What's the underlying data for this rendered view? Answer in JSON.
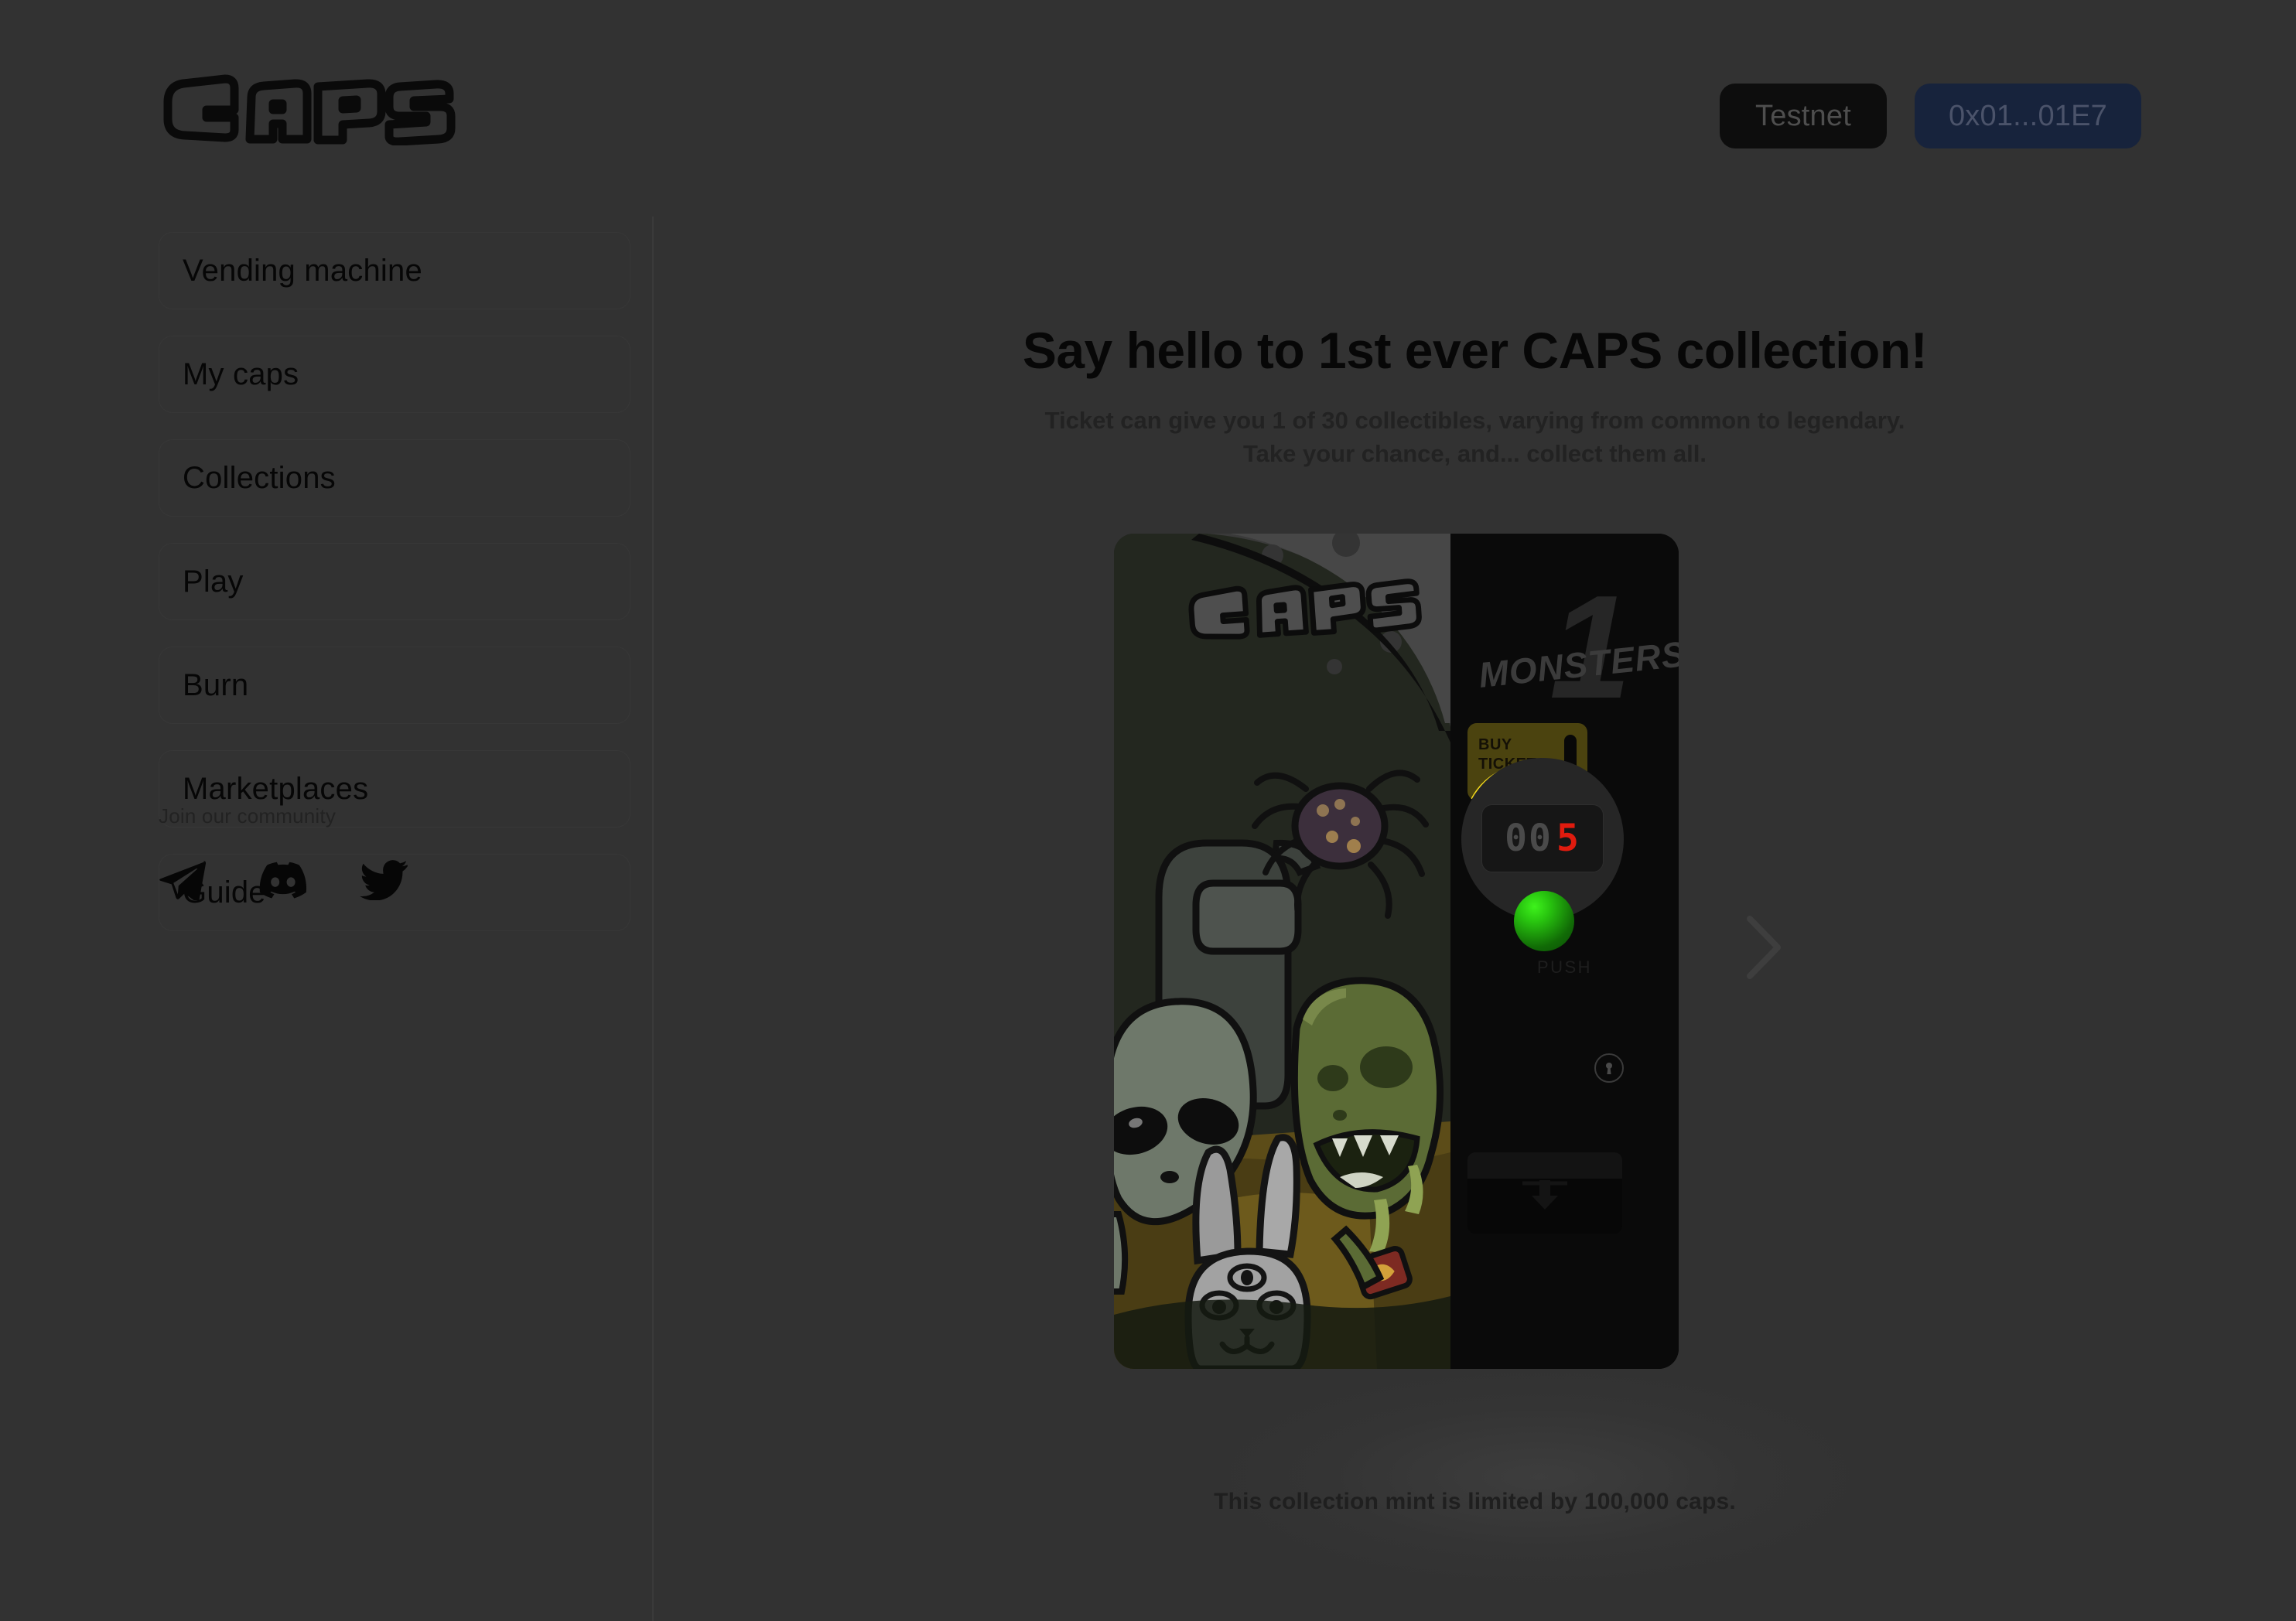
{
  "header": {
    "logo_text": "CAPS",
    "logo_icon": "caps-wordmark-logo",
    "network_label": "Testnet",
    "wallet_label": "0x01...01E7"
  },
  "sidebar": {
    "items": [
      {
        "label": "Vending machine",
        "name": "vending-machine"
      },
      {
        "label": "My caps",
        "name": "my-caps"
      },
      {
        "label": "Collections",
        "name": "collections"
      },
      {
        "label": "Play",
        "name": "play"
      },
      {
        "label": "Burn",
        "name": "burn"
      },
      {
        "label": "Marketplaces",
        "name": "marketplaces"
      },
      {
        "label": "Guide",
        "name": "guide"
      }
    ],
    "community": {
      "title": "Join our community",
      "socials": [
        {
          "icon": "telegram-icon",
          "name": "telegram"
        },
        {
          "icon": "discord-icon",
          "name": "discord"
        },
        {
          "icon": "twitter-icon",
          "name": "twitter"
        }
      ]
    }
  },
  "main": {
    "title": "Say hello to 1st ever CAPS collection!",
    "subtitle_line1": "Ticket can give you 1 of 30 collectibles, varying from common to legendary.",
    "subtitle_line2": "Take your chance, and... collect them all.",
    "footnote": "This collection mint is limited by 100,000 caps.",
    "carousel_next_icon": "chevron-right-icon",
    "machine": {
      "poster_logo": "CAPS",
      "brand_number": "1",
      "brand_name": "MONSTERS",
      "ticket_label_line1": "BUY",
      "ticket_label_line2": "TICKETS",
      "counter_dim": "00",
      "counter_on": "5",
      "push_label": "PUSH",
      "keyhole_icon": "keyhole-icon",
      "tray_icon": "down-arrow-icon"
    }
  },
  "colors": {
    "background": "#323232",
    "panel_black": "#0a0a0a",
    "wallet_pill": "#17233c",
    "ticket_yellow": "#f2d81c",
    "counter_red": "#e01b0e",
    "push_green": "#28c40f"
  }
}
